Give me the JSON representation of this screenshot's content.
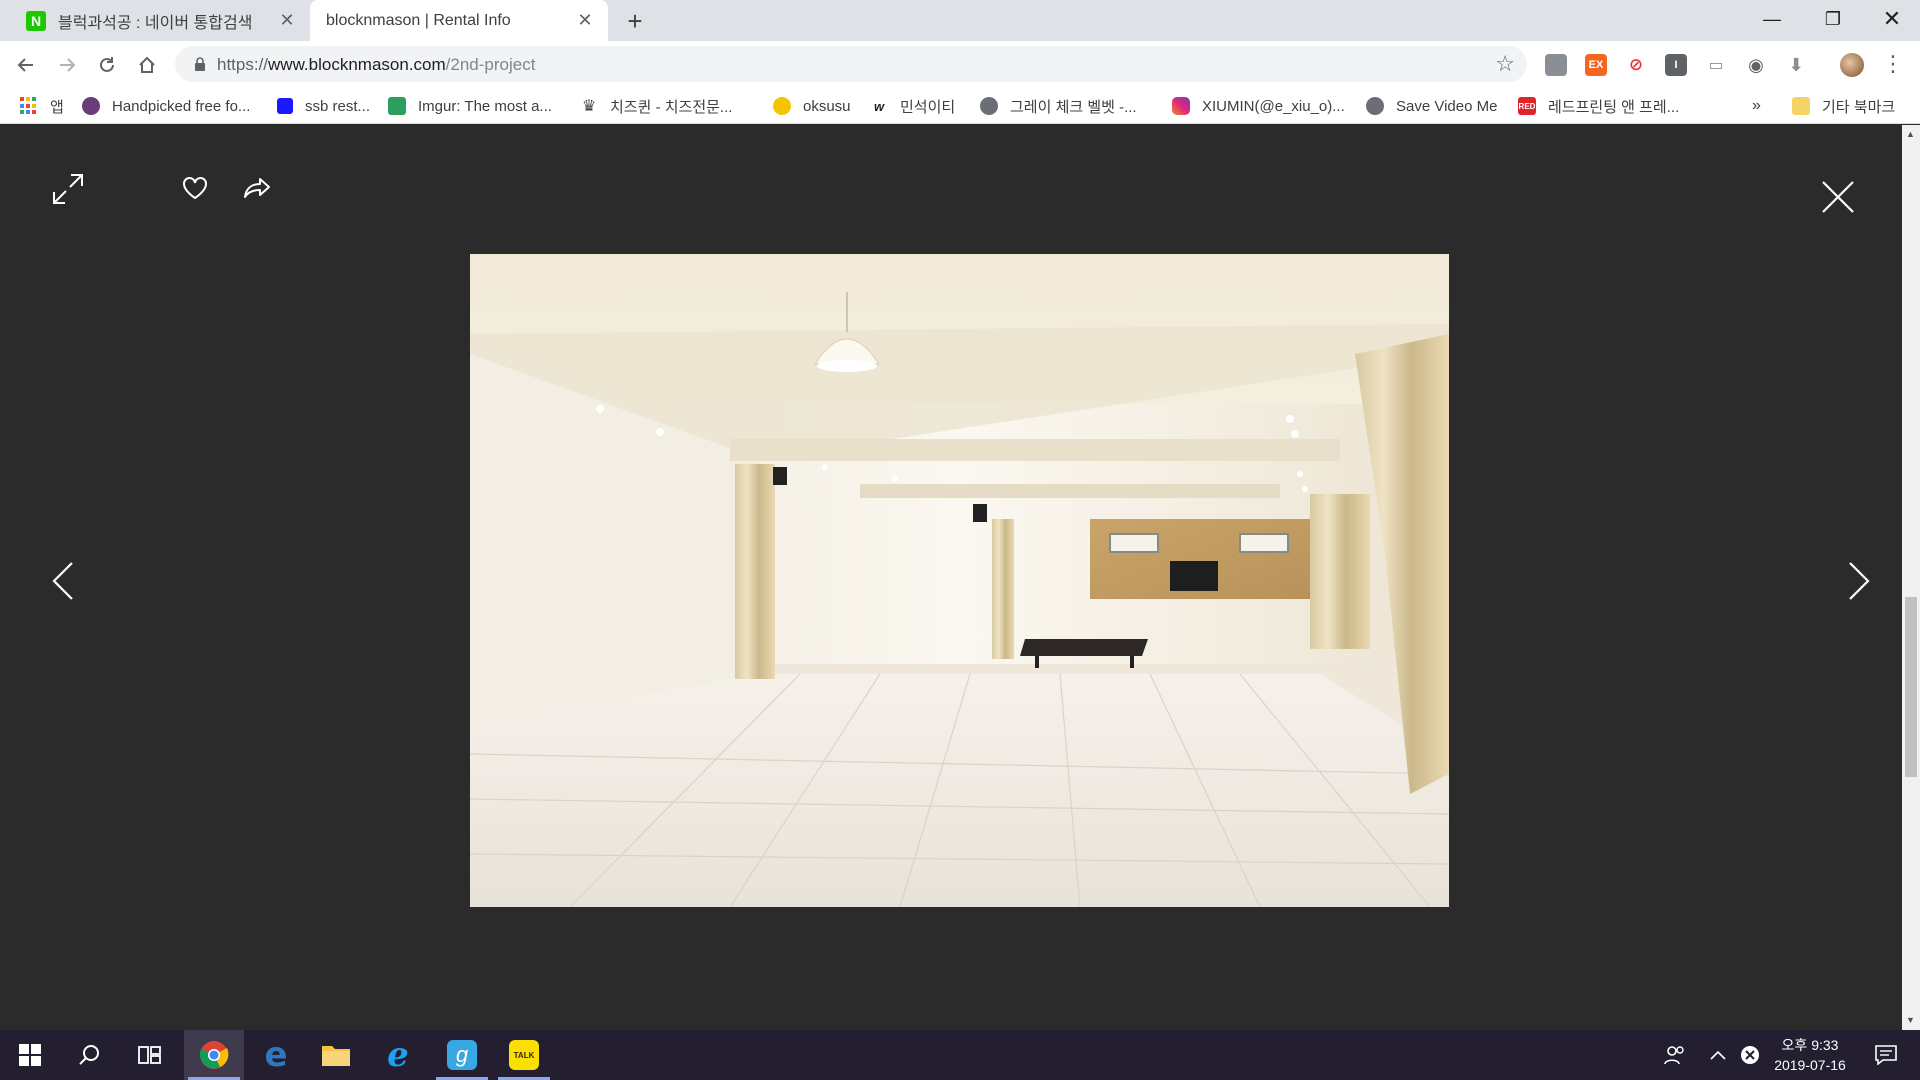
{
  "browser": {
    "tabs": [
      {
        "title": "블럭과석공 : 네이버 통합검색",
        "favicon_letter": "N",
        "active": false
      },
      {
        "title": "blocknmason | Rental Info",
        "favicon_letter": "",
        "active": true
      }
    ],
    "address": {
      "scheme": "https://",
      "host": "www.blocknmason.com",
      "path": "/2nd-project"
    },
    "bookmarks": [
      {
        "label": "앱",
        "icon": "apps-grid-icon"
      },
      {
        "label": "Handpicked free fo...",
        "icon": "brush-icon"
      },
      {
        "label": "ssb rest...",
        "icon": "blue-square-icon"
      },
      {
        "label": "Imgur: The most a...",
        "icon": "imgur-icon"
      },
      {
        "label": "치즈퀸 - 치즈전문...",
        "icon": "crown-icon"
      },
      {
        "label": "oksusu",
        "icon": "oksusu-icon"
      },
      {
        "label": "민석이티",
        "icon": "w-icon"
      },
      {
        "label": "그레이 체크 벨벳 -...",
        "icon": "globe-icon"
      },
      {
        "label": "XIUMIN(@e_xiu_o)...",
        "icon": "instagram-icon"
      },
      {
        "label": "Save Video Me",
        "icon": "globe-icon"
      },
      {
        "label": "레드프린팅 앤 프레...",
        "icon": "red-icon"
      }
    ],
    "bookmarks_overflow": "»",
    "other_bookmarks": "기타 북마크",
    "extensions": [
      {
        "name": "puzzle-icon",
        "label": "",
        "color": "#8a8f96"
      },
      {
        "name": "ex-extension-icon",
        "label": "EX",
        "color": "#f26522"
      },
      {
        "name": "block-extension-icon",
        "label": "⊘",
        "color": "#e53935"
      },
      {
        "name": "info-extension-icon",
        "label": "I",
        "color": "#5f6368"
      },
      {
        "name": "cast-extension-icon",
        "label": "▭",
        "color": "#8a8f96"
      },
      {
        "name": "camera-extension-icon",
        "label": "◉",
        "color": "#5f6368"
      },
      {
        "name": "download-extension-icon",
        "label": "⬇",
        "color": "#8a8f96"
      }
    ]
  },
  "lightbox": {
    "photo_alt": "Empty white rental studio with tiled floor, curtains and a bench"
  },
  "taskbar": {
    "clock_period": "오후 9:33",
    "clock_date": "2019-07-16"
  }
}
